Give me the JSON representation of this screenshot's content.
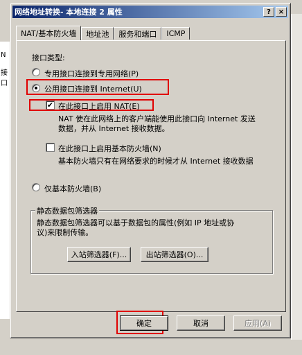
{
  "window": {
    "title": "网络地址转换- 本地连接 2 属性",
    "help_btn": "?",
    "close_btn": "×"
  },
  "tabs": [
    "NAT/基本防火墙",
    "地址池",
    "服务和端口",
    "ICMP"
  ],
  "interface_type": {
    "label": "接口类型:",
    "options": [
      "专用接口连接到专用网络(P)",
      "公用接口连接到 Internet(U)",
      "仅基本防火墙(B)"
    ],
    "selected": 1
  },
  "nat": {
    "label": "在此接口上启用 NAT(E)",
    "checked": true,
    "desc": [
      "NAT 使在此网络上的客户端能使用此接口向 Internet 发送",
      "数据，并从 Internet 接收数据。"
    ]
  },
  "firewall": {
    "label": "在此接口上启用基本防火墙(N)",
    "checked": false,
    "desc": [
      "基本防火墙只有在网络要求的时候才从 Internet 接收数据"
    ]
  },
  "packet_filters": {
    "title": "静态数据包筛选器",
    "desc": [
      "静态数据包筛选器可以基于数据包的属性(例如 IP 地址或协",
      "议)来限制传输。"
    ],
    "inbound": "入站筛选器(F)...",
    "outbound": "出站筛选器(O)..."
  },
  "buttons": {
    "ok": "确定",
    "cancel": "取消",
    "apply": "应用(A)"
  },
  "background": {
    "left_labels": [
      "N",
      "接口"
    ]
  },
  "colors": {
    "highlight": "#e00000",
    "titlebar": "#0a246a"
  }
}
